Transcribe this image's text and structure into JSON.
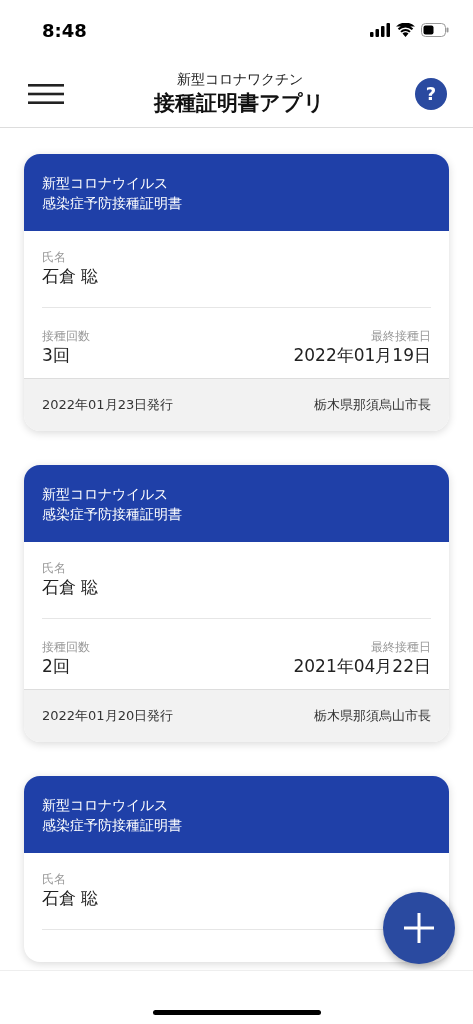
{
  "status_bar": {
    "time": "8:48"
  },
  "header": {
    "subtitle": "新型コロナワクチン",
    "title": "接種証明書アプリ",
    "help": "?"
  },
  "cards": [
    {
      "title_lines": [
        "新型コロナウイルス",
        "感染症予防接種証明書"
      ],
      "name_label": "氏名",
      "name": "石倉 聡",
      "count_label": "接種回数",
      "count": "3回",
      "last_date_label": "最終接種日",
      "last_date": "2022年01月19日",
      "issued": "2022年01月23日発行",
      "issuer": "栃木県那須烏山市長"
    },
    {
      "title_lines": [
        "新型コロナウイルス",
        "感染症予防接種証明書"
      ],
      "name_label": "氏名",
      "name": "石倉 聡",
      "count_label": "接種回数",
      "count": "2回",
      "last_date_label": "最終接種日",
      "last_date": "2021年04月22日",
      "issued": "2022年01月20日発行",
      "issuer": "栃木県那須烏山市長"
    },
    {
      "title_lines": [
        "新型コロナウイルス",
        "感染症予防接種証明書"
      ],
      "name_label": "氏名",
      "name": "石倉 聡"
    }
  ]
}
